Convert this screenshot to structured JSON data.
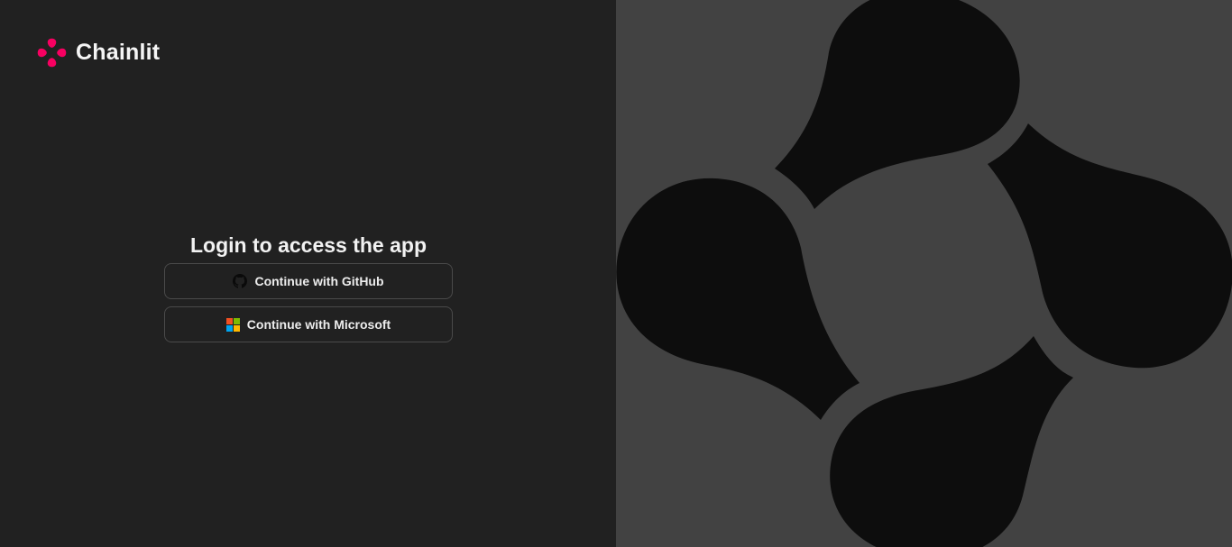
{
  "brand": {
    "name": "Chainlit",
    "logo_icon": "chainlit-logo-icon",
    "accent_color": "#f80061"
  },
  "login": {
    "title": "Login to access the app",
    "providers": [
      {
        "label": "Continue with GitHub",
        "icon": "github-icon"
      },
      {
        "label": "Continue with Microsoft",
        "icon": "microsoft-icon"
      }
    ]
  },
  "colors": {
    "left_background": "#212121",
    "right_background": "#424242",
    "hero_shape": "#0d0d0d",
    "microsoft": [
      "#f25022",
      "#7fba00",
      "#00a4ef",
      "#ffb900"
    ]
  }
}
